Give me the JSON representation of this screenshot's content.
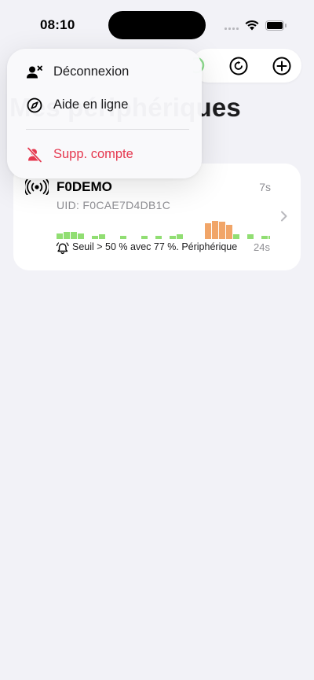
{
  "status_bar": {
    "time": "08:10"
  },
  "page": {
    "title": "Mes périphériques"
  },
  "menu": {
    "items": [
      {
        "label": "Déconnexion",
        "icon": "person-xmark-icon"
      },
      {
        "label": "Aide en ligne",
        "icon": "compass-icon"
      },
      {
        "label": "Supp. compte",
        "icon": "person-slash-icon",
        "destructive": true
      }
    ]
  },
  "toolbar": {
    "status": "green-status-indicator",
    "refresh_icon": "refresh-icon",
    "add_icon": "add-icon"
  },
  "device": {
    "name": "F0DEMO",
    "uid": "UID: F0CAE7D4DB1C",
    "elapsed": "7s",
    "alert_text": "Seuil > 50 % avec 77 %. Périphérique",
    "alert_time": "24s",
    "chart_levels": [
      0.2,
      0.25,
      0.25,
      0.18,
      0,
      0.12,
      0.15,
      0,
      0,
      0.12,
      0,
      0,
      0.12,
      0,
      0.12,
      0,
      0.12,
      0.15,
      0,
      0,
      0,
      0.55,
      0.62,
      0.6,
      0.5,
      0.15,
      0,
      0.15,
      0,
      0.12,
      0.1
    ]
  },
  "colors": {
    "accent_green": "#7ed85a",
    "accent_orange": "#f0a060",
    "destructive": "#e5384f"
  }
}
